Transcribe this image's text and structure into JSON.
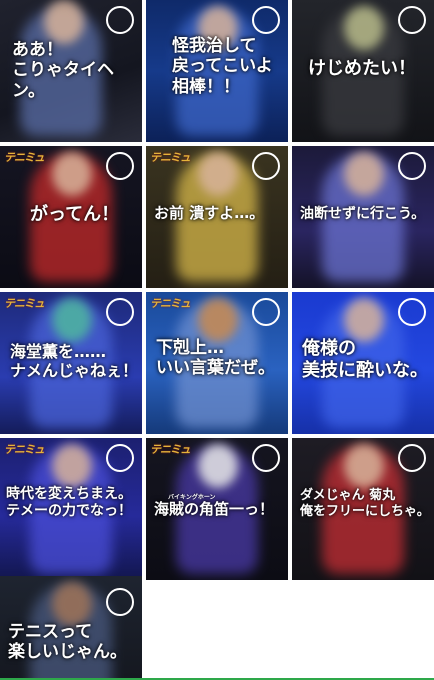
{
  "logo_text": "テニミュ",
  "tiles": [
    {
      "caption": "ああ！\nこりゃタイヘン。"
    },
    {
      "caption": "怪我治して\n戻ってこいよ\n相棒！！"
    },
    {
      "caption": "けじめたい！"
    },
    {
      "caption": "がってん！"
    },
    {
      "caption": "お前 潰すよ…。"
    },
    {
      "caption": "油断せずに行こう。"
    },
    {
      "caption": "海堂薫を……\nナメんじゃねぇ！"
    },
    {
      "caption": "下剋上…\nいい言葉だぜ。"
    },
    {
      "caption": "俺様の\n美技に酔いな。"
    },
    {
      "caption": "時代を変えちまえ。\nテメーの力でなっ！"
    },
    {
      "caption": "海賊の角笛一っ！",
      "ruby": "バイキングホーン"
    },
    {
      "caption": "ダメじゃん 菊丸\n俺をフリーにしちゃ。"
    },
    {
      "caption": "テニスって\n楽しいじゃん。"
    }
  ]
}
